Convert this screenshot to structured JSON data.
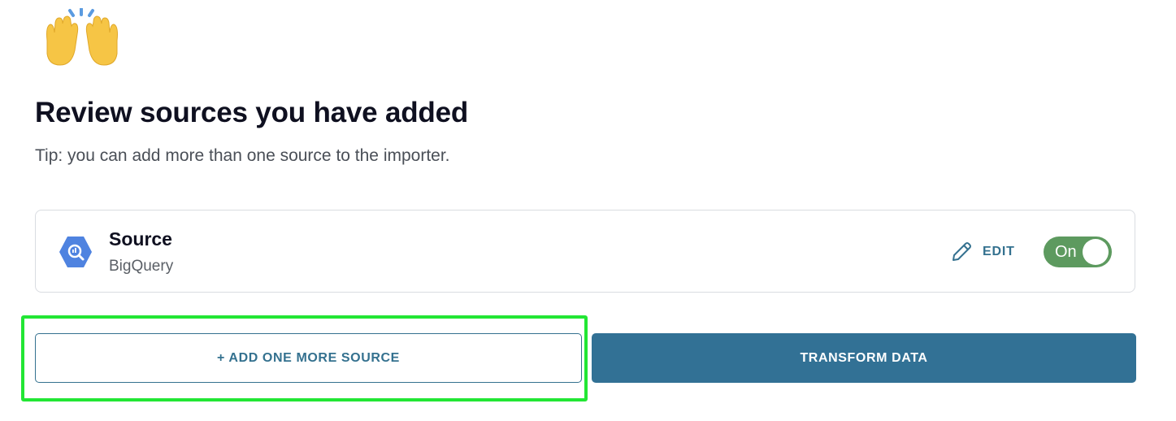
{
  "header": {
    "icon": "raising-hands-emoji",
    "title": "Review sources you have added",
    "tip": "Tip: you can add more than one source to the importer."
  },
  "source": {
    "icon": "bigquery-icon",
    "name": "Source",
    "type": "BigQuery",
    "edit_label": "EDIT",
    "toggle_label": "On",
    "toggle_state": true,
    "toggle_color": "#5d9a5f"
  },
  "actions": {
    "add_label": "+ ADD ONE MORE SOURCE",
    "transform_label": "TRANSFORM DATA",
    "primary_color": "#327195"
  },
  "highlight_color": "#22e634"
}
